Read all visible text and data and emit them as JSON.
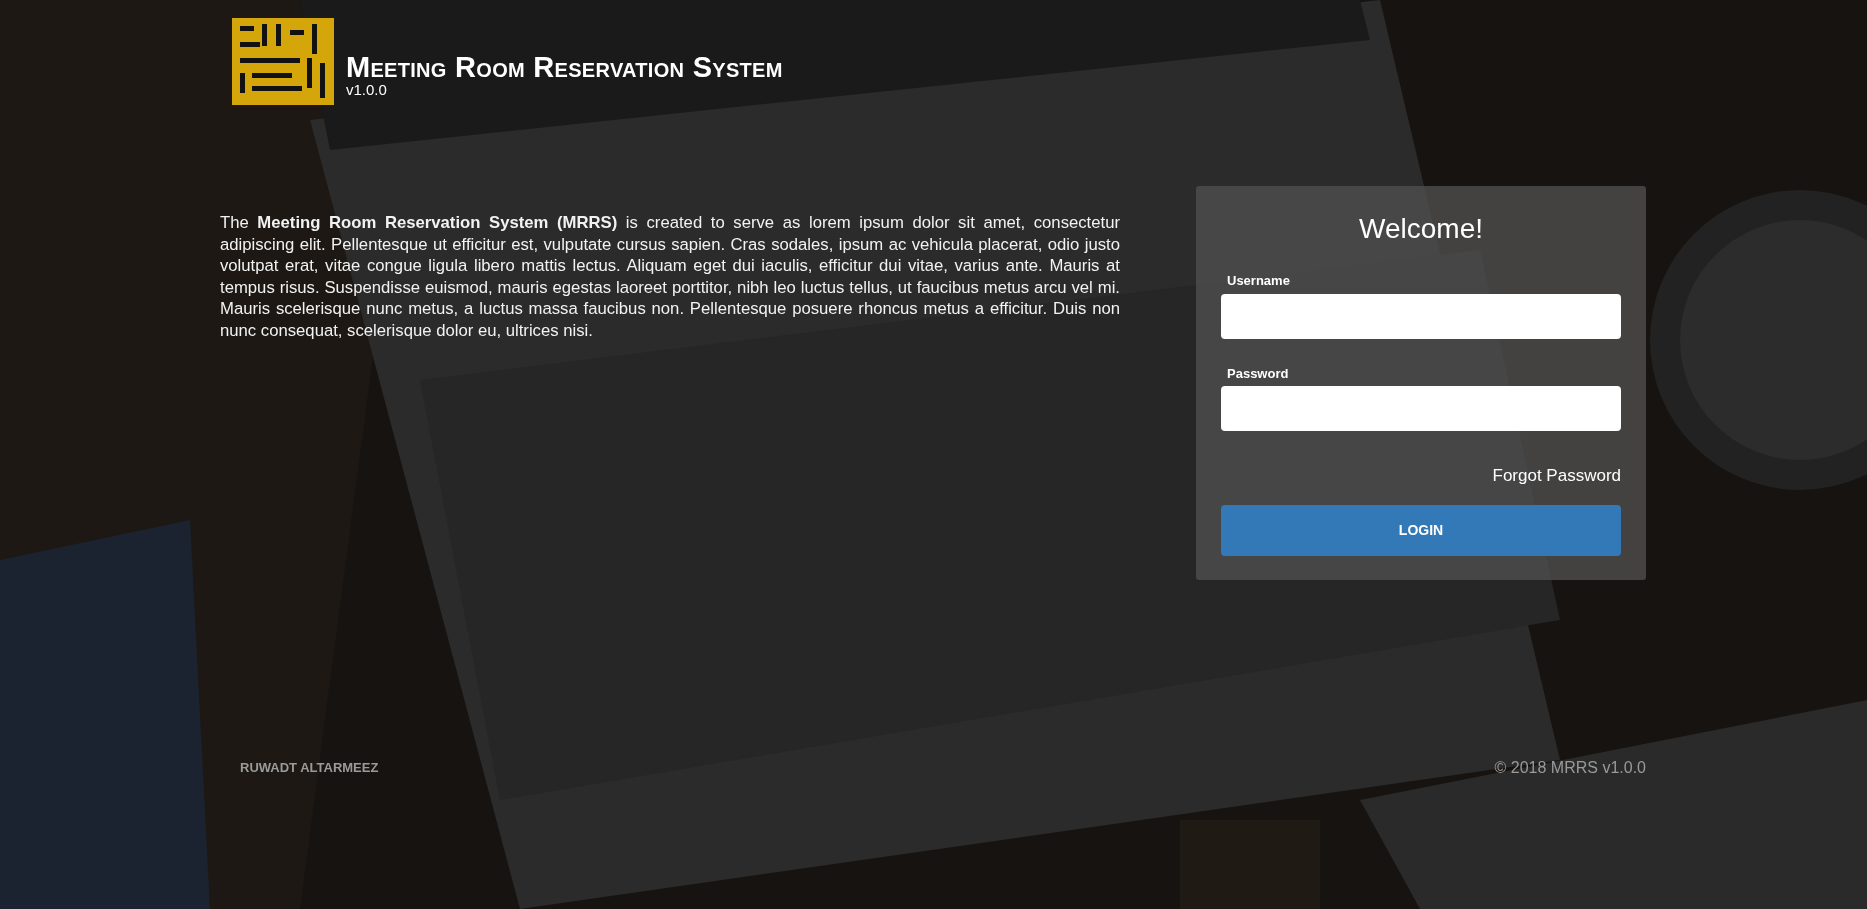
{
  "header": {
    "title": "Meeting Room Reservation System",
    "version": "v1.0.0"
  },
  "intro": {
    "text": "The **Meeting Room Reservation System (MRRS)** is created to serve as lorem ipsum dolor sit amet, consectetur adipiscing elit. Pellentesque ut efficitur est, vulputate cursus sapien. Cras sodales, ipsum ac vehicula placerat, odio justo volutpat erat, vitae congue ligula libero mattis lectus. Aliquam eget dui iaculis, efficitur dui vitae, varius ante. Mauris at tempus risus. Suspendisse euismod, mauris egestas laoreet porttitor, nibh leo luctus tellus, ut faucibus metus arcu vel mi. Mauris scelerisque nunc metus, a luctus massa faucibus non. Pellentesque posuere rhoncus metus a efficitur. Duis non nunc consequat, scelerisque dolor eu, ultrices nisi."
  },
  "login": {
    "title": "Welcome!",
    "fields": [
      {
        "label": "Username"
      },
      {
        "label": "Password"
      }
    ],
    "forgot_link": "Forgot Password",
    "button": "LOGIN"
  },
  "footer": {
    "company": "RUWADT ALTARMEEZ",
    "copyright": "© 2018 MRRS v1.0.0"
  }
}
